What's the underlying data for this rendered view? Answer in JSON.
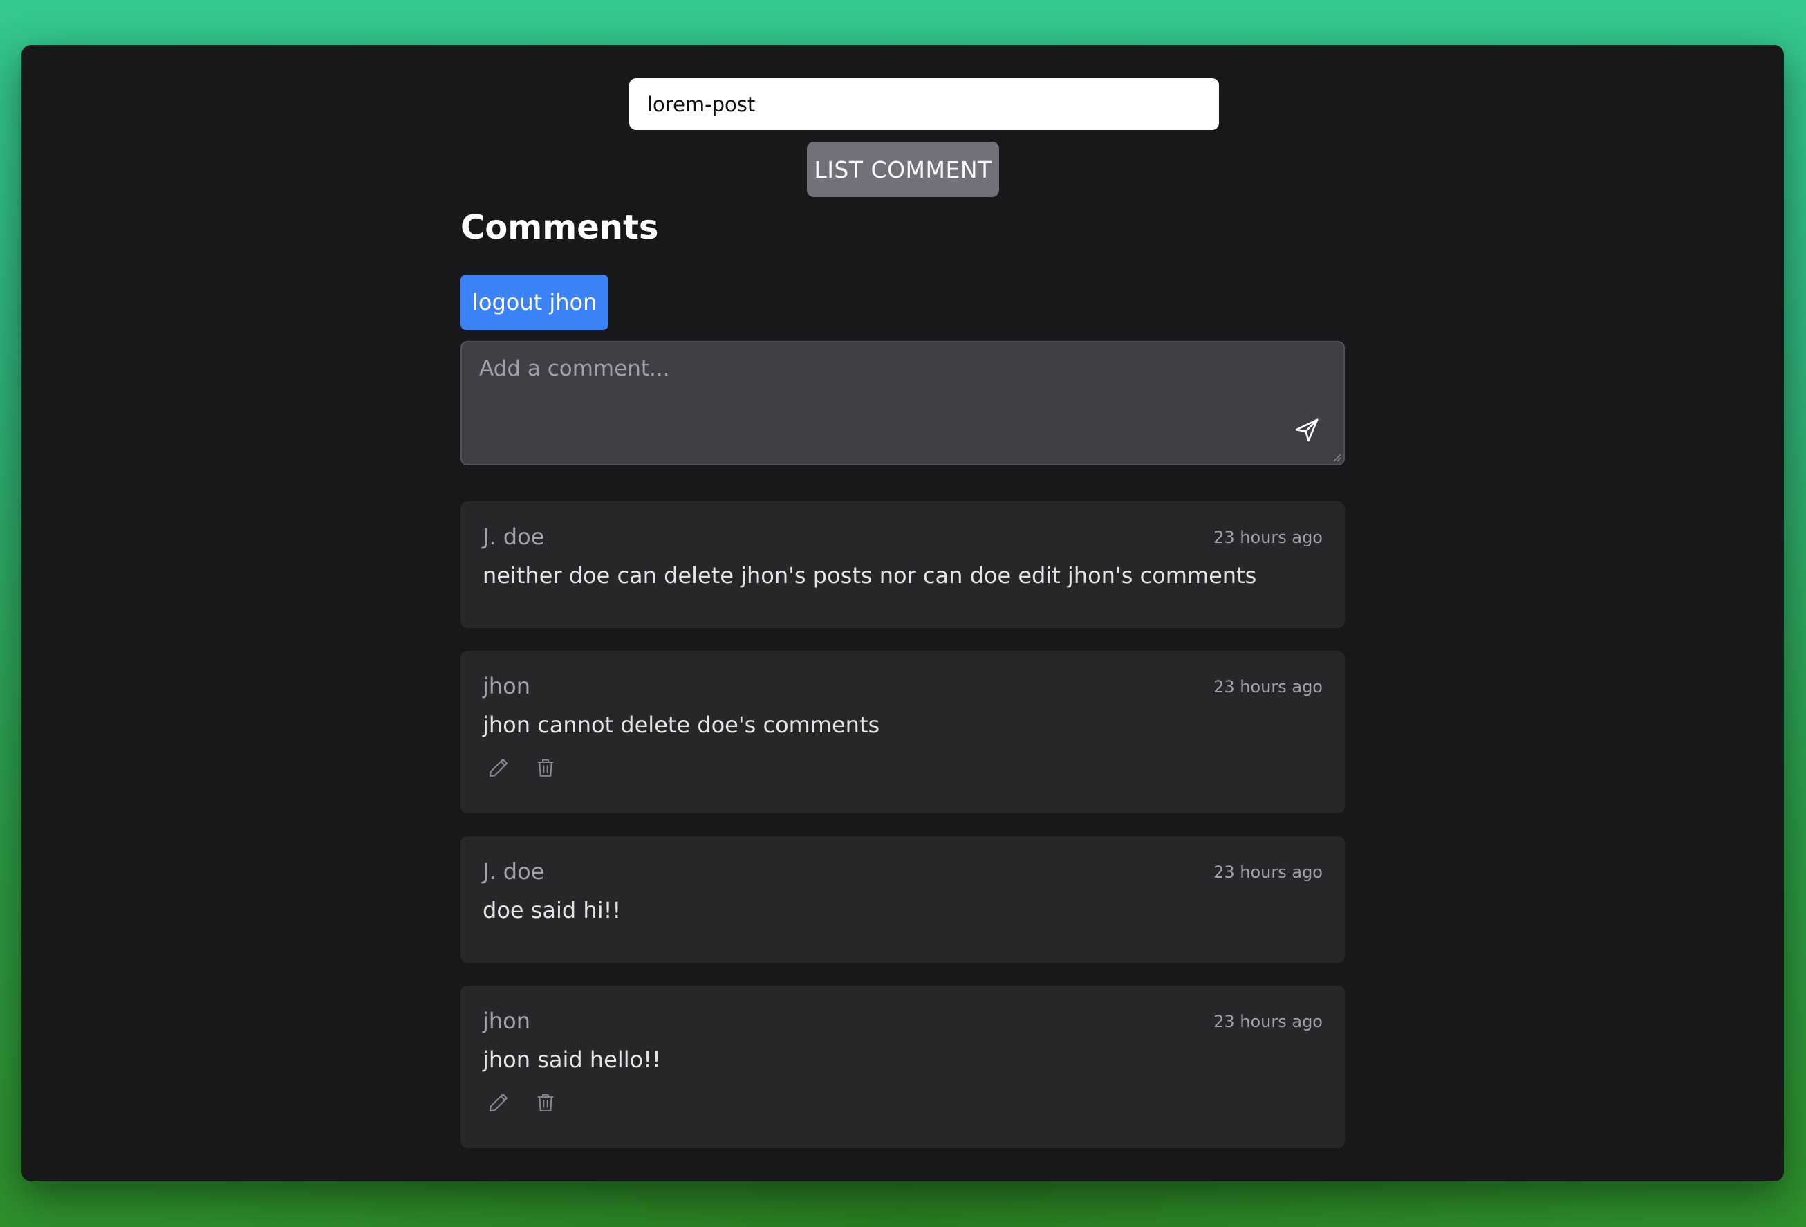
{
  "post_lookup": {
    "value": "lorem-post",
    "button_label": "LIST COMMENT"
  },
  "comments_section": {
    "heading": "Comments",
    "logout_label": "logout jhon",
    "composer_placeholder": "Add a comment...",
    "send_icon": "send-icon"
  },
  "comments": [
    {
      "author": "J. doe",
      "time": "23 hours ago",
      "text": "neither doe can delete jhon's posts nor can doe edit jhon's comments",
      "editable": false
    },
    {
      "author": "jhon",
      "time": "23 hours ago",
      "text": "jhon cannot delete doe's comments",
      "editable": true
    },
    {
      "author": "J. doe",
      "time": "23 hours ago",
      "text": "doe said hi!!",
      "editable": false
    },
    {
      "author": "jhon",
      "time": "23 hours ago",
      "text": "jhon said hello!!",
      "editable": true
    }
  ],
  "colors": {
    "window_bg": "#18181b",
    "card_bg": "#27272a",
    "accent_blue": "#3b82f6",
    "list_button": "#71717a"
  }
}
